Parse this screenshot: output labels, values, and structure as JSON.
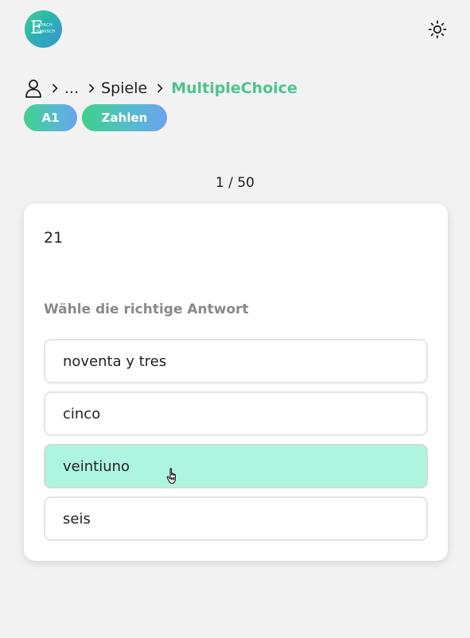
{
  "header": {
    "logo_text": "Einfach Spanisch",
    "logo_letter": "E",
    "logo_lines": [
      "INFACH",
      "PANISCH"
    ],
    "theme_icon": "sun-icon"
  },
  "breadcrumb": {
    "home_icon": "user-icon",
    "ellipsis": "...",
    "parent": "Spiele",
    "current": "MultipleChoice"
  },
  "tags": {
    "level": "A1",
    "topic": "Zahlen"
  },
  "quiz": {
    "progress": "1 / 50",
    "prompt": "21",
    "instruction": "Wähle die richtige Antwort",
    "options": [
      "noventa y tres",
      "cinco",
      "veintiuno",
      "seis"
    ],
    "hovered_option": "veintiuno"
  },
  "colors": {
    "accent": "#4cc48f",
    "option_hover": "#aef5e0",
    "background": "#f2f2f2"
  }
}
